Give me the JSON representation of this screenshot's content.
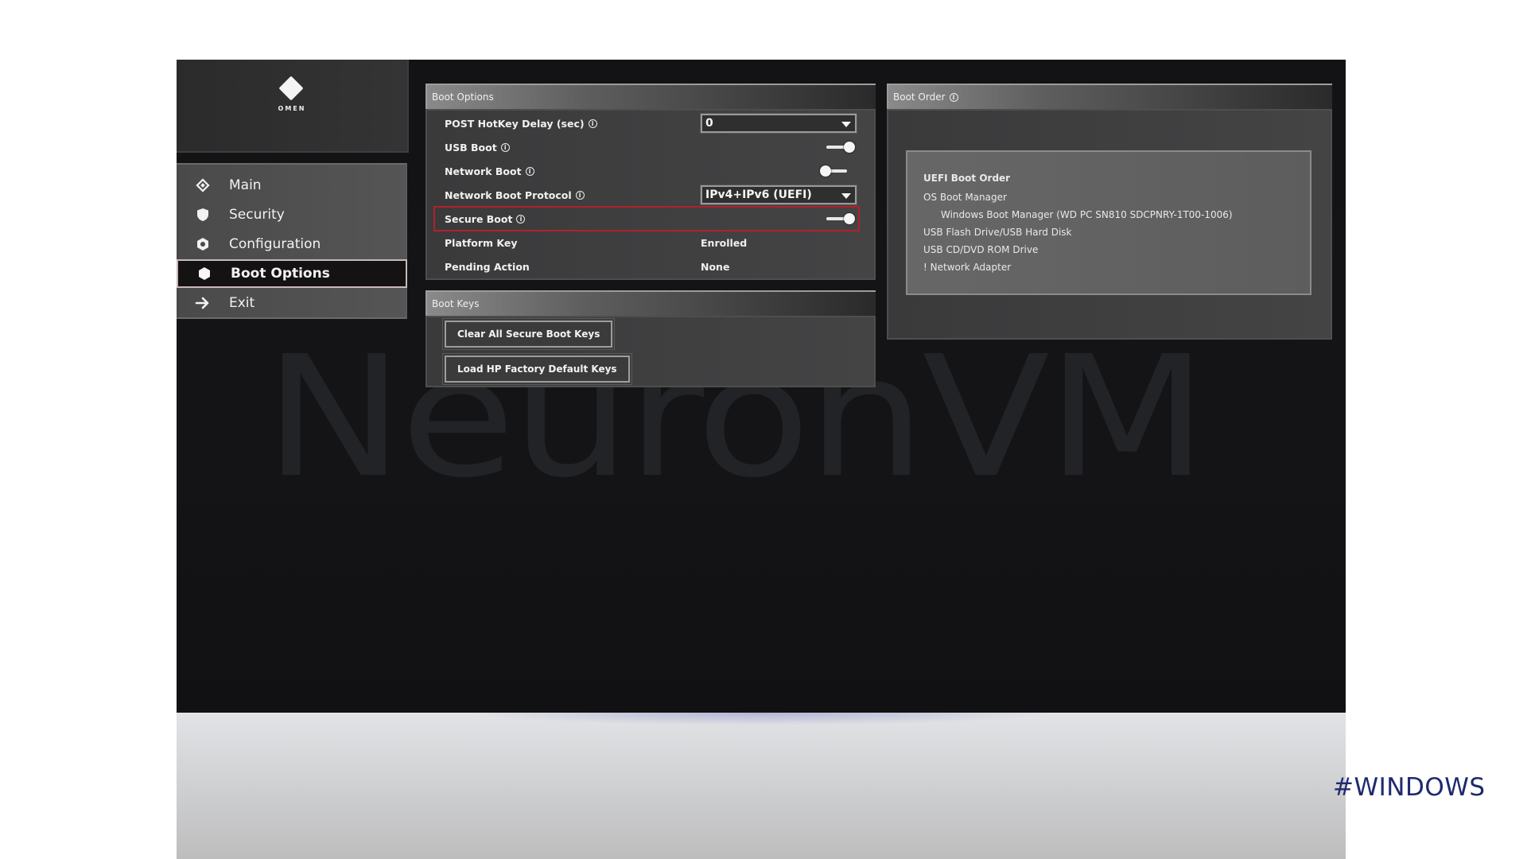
{
  "brand": {
    "logo_text": "OMEN"
  },
  "sidebar": {
    "items": [
      {
        "label": "Main",
        "icon": "diamond-outline-icon",
        "active": false
      },
      {
        "label": "Security",
        "icon": "shield-icon",
        "active": false
      },
      {
        "label": "Configuration",
        "icon": "gear-icon",
        "active": false
      },
      {
        "label": "Boot Options",
        "icon": "diamond-filled-icon",
        "active": true
      },
      {
        "label": "Exit",
        "icon": "arrow-right-icon",
        "active": false
      }
    ]
  },
  "boot_options": {
    "title": "Boot Options",
    "rows": [
      {
        "label": "POST HotKey Delay (sec)",
        "info": true,
        "type": "select",
        "value": "0"
      },
      {
        "label": "USB Boot",
        "info": true,
        "type": "toggle",
        "value": "on"
      },
      {
        "label": "Network Boot",
        "info": true,
        "type": "toggle",
        "value": "off"
      },
      {
        "label": "Network Boot Protocol",
        "info": true,
        "type": "select",
        "value": "IPv4+IPv6 (UEFI)"
      },
      {
        "label": "Secure Boot",
        "info": true,
        "type": "toggle",
        "value": "on",
        "highlighted": true
      },
      {
        "label": "Platform Key",
        "info": false,
        "type": "text",
        "value": "Enrolled"
      },
      {
        "label": "Pending Action",
        "info": false,
        "type": "text",
        "value": "None"
      }
    ]
  },
  "boot_keys": {
    "title": "Boot Keys",
    "buttons": [
      "Clear All Secure Boot Keys",
      "Load HP Factory Default Keys"
    ]
  },
  "boot_order": {
    "title": "Boot Order",
    "heading": "UEFI Boot Order",
    "items": [
      {
        "label": "OS Boot Manager",
        "indent": false
      },
      {
        "label": "Windows Boot Manager (WD PC SN810 SDCPNRY-1T00-1006)",
        "indent": true
      },
      {
        "label": "USB Flash Drive/USB Hard Disk",
        "indent": false
      },
      {
        "label": "USB CD/DVD ROM Drive",
        "indent": false
      },
      {
        "label": "! Network Adapter",
        "indent": false
      }
    ]
  },
  "overlay": {
    "watermark": "NeuronVM",
    "hashtag": "#WINDOWS"
  },
  "colors": {
    "highlight_border": "#b0222b",
    "hashtag": "#1e2a6e"
  },
  "info_glyph": "i"
}
